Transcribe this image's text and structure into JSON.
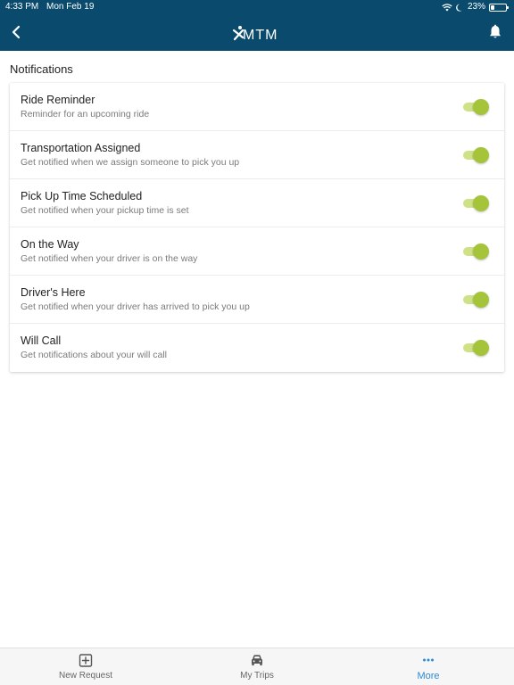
{
  "status_bar": {
    "time": "4:33 PM",
    "date": "Mon Feb 19",
    "battery": "23%",
    "battery_level": 0.23
  },
  "header": {
    "logo_text": "MTM",
    "background": "#0a4b6d"
  },
  "section": {
    "title": "Notifications"
  },
  "notifications": [
    {
      "title": "Ride Reminder",
      "subtitle": "Reminder for an upcoming ride",
      "enabled": true
    },
    {
      "title": "Transportation Assigned",
      "subtitle": "Get notified when we assign someone to pick you up",
      "enabled": true
    },
    {
      "title": "Pick Up Time Scheduled",
      "subtitle": "Get notified when your pickup time is set",
      "enabled": true
    },
    {
      "title": "On the Way",
      "subtitle": "Get notified when your driver is on the way",
      "enabled": true
    },
    {
      "title": "Driver's Here",
      "subtitle": "Get notified when your driver has arrived to pick you up",
      "enabled": true
    },
    {
      "title": "Will Call",
      "subtitle": "Get notifications about your will call",
      "enabled": true
    }
  ],
  "tabbar": {
    "tabs": [
      {
        "label": "New Request",
        "icon": "plus-square-icon",
        "active": false
      },
      {
        "label": "My Trips",
        "icon": "car-icon",
        "active": false
      },
      {
        "label": "More",
        "icon": "more-dots-icon",
        "active": true
      }
    ]
  },
  "colors": {
    "toggle_on_thumb": "#a5c43a",
    "toggle_on_track": "#cfe187",
    "active_tab": "#2a8ad6"
  }
}
